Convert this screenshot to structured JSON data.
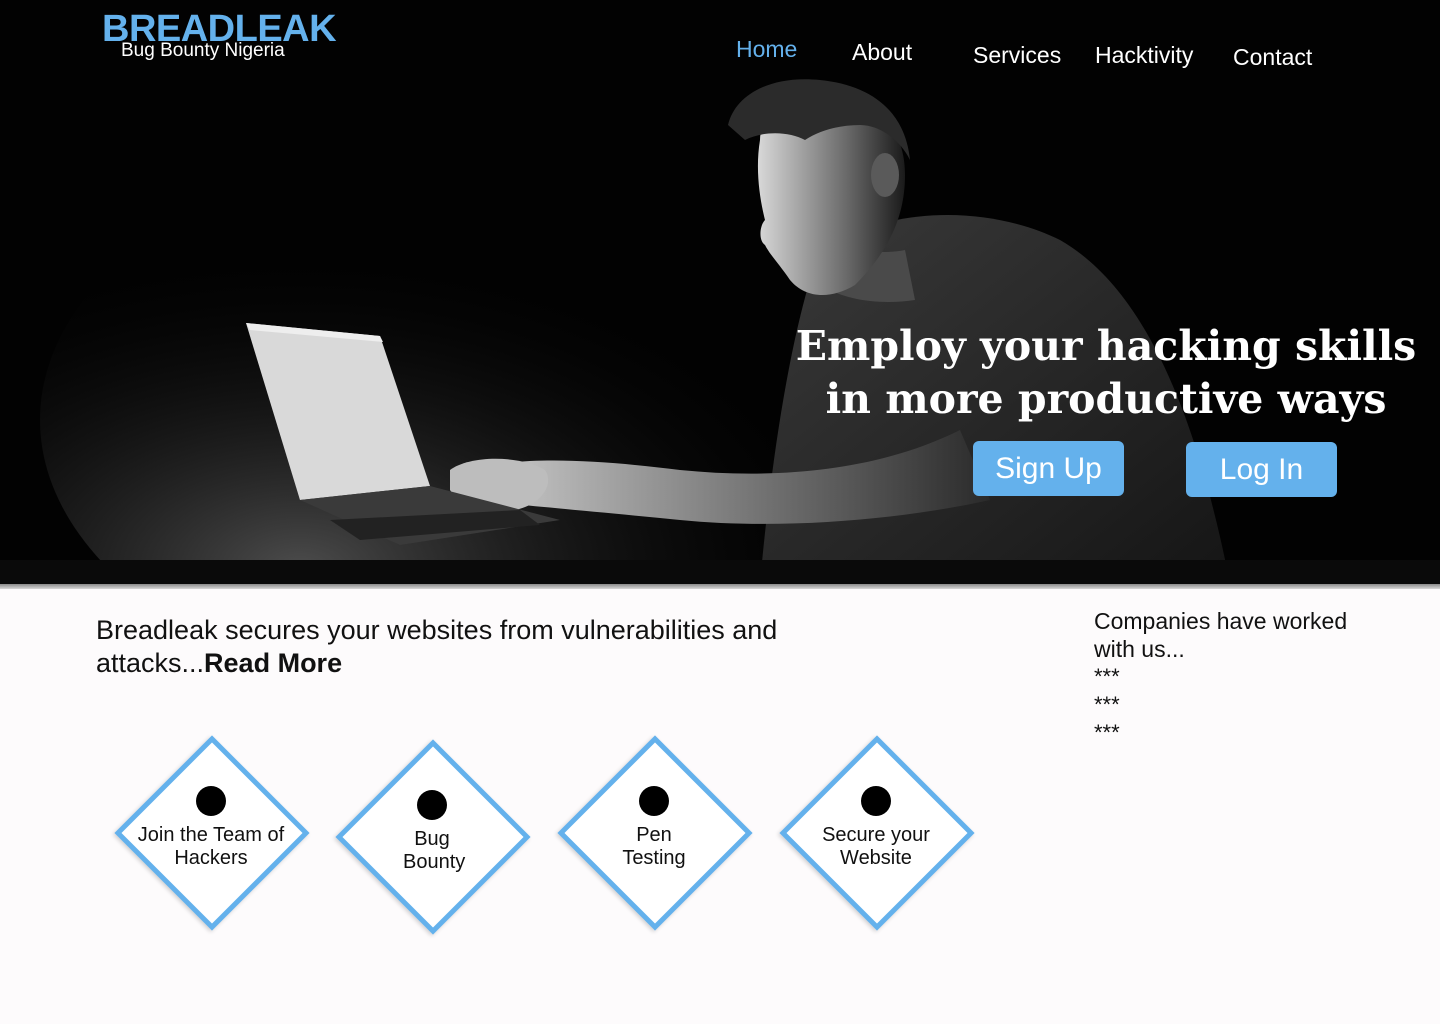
{
  "brand": {
    "title": "BREADLEAK",
    "subtitle": "Bug Bounty Nigeria"
  },
  "nav": {
    "items": [
      {
        "label": "Home",
        "active": true
      },
      {
        "label": "About",
        "active": false
      },
      {
        "label": "Services",
        "active": false
      },
      {
        "label": "Hacktivity",
        "active": false
      },
      {
        "label": "Contact",
        "active": false
      }
    ]
  },
  "hero": {
    "headline_line1": "Employ your hacking skills",
    "headline_line2": "in more productive ways",
    "signup_label": "Sign Up",
    "login_label": "Log In",
    "image_icon": "hacker-at-laptop-photo"
  },
  "intro": {
    "text": "Breadleak secures your websites from vulnerabilities and attacks...",
    "read_more": "Read More"
  },
  "companies": {
    "title": "Companies have worked with us...",
    "items": [
      "***",
      "***",
      "***"
    ]
  },
  "services": {
    "tiles": [
      {
        "label": "Join the Team of Hackers",
        "icon": "dot-icon"
      },
      {
        "label": "Bug Bounty",
        "icon": "dot-icon"
      },
      {
        "label": "Pen Testing",
        "icon": "dot-icon"
      },
      {
        "label": "Secure your Website",
        "icon": "dot-icon"
      }
    ]
  },
  "colors": {
    "accent": "#64b1ec",
    "hero_background": "#000000",
    "page_background": "#fdfbfc"
  }
}
